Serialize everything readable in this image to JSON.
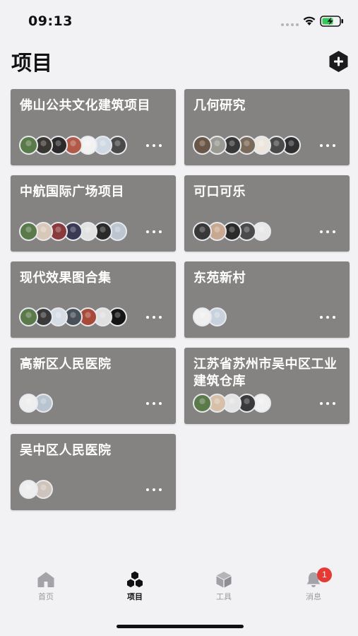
{
  "status_bar": {
    "time": "09:13"
  },
  "header": {
    "title": "项目",
    "add_icon": "plus-hexagon-icon"
  },
  "projects": [
    {
      "title": "佛山公共文化建筑项目",
      "avatars": [
        "#5a7a4a",
        "#3a3632",
        "#2a2a2a",
        "#b25a48",
        "#f2f2f2",
        "#cfd9e3",
        "#4a4a4a"
      ]
    },
    {
      "title": "几何研究",
      "avatars": [
        "#6a5646",
        "#9a9a92",
        "#383838",
        "#7a6a5a",
        "#ece6dc",
        "#4a4a4a",
        "#2f2f2f"
      ]
    },
    {
      "title": "中航国际广场项目",
      "avatars": [
        "#5a7a4a",
        "#d8c8b8",
        "#8a3a3a",
        "#3a3a55",
        "#e2e2e2",
        "#2a2a2a",
        "#bcc6d0"
      ]
    },
    {
      "title": "可口可乐",
      "avatars": [
        "#383838",
        "#c8a890",
        "#2a2a2a",
        "#4a4a4a",
        "#e8e8e8"
      ]
    },
    {
      "title": "现代效果图合集",
      "avatars": [
        "#5a7a4a",
        "#3a3a3a",
        "#d6dde4",
        "#4a5058",
        "#a84a3a",
        "#e0e0e0",
        "#151515"
      ]
    },
    {
      "title": "东苑新村",
      "avatars": [
        "#f0f0f0",
        "#c8d2dc"
      ]
    },
    {
      "title": "高新区人民医院",
      "avatars": [
        "#eeeeee",
        "#b8c4d0"
      ]
    },
    {
      "title": "江苏省苏州市吴中区工业建筑仓库",
      "avatars": [
        "#5a7a4a",
        "#d8c0a8",
        "#e4e4e4",
        "#3a3a3a",
        "#f0f0f0"
      ]
    },
    {
      "title": "吴中区人民医院",
      "avatars": [
        "#eeeeee",
        "#cfc4bc"
      ]
    }
  ],
  "tabs": [
    {
      "label": "首页",
      "icon": "home-icon"
    },
    {
      "label": "项目",
      "icon": "hexagons-icon"
    },
    {
      "label": "工具",
      "icon": "cube-icon"
    },
    {
      "label": "消息",
      "icon": "bell-icon"
    }
  ],
  "notification_count": "1"
}
